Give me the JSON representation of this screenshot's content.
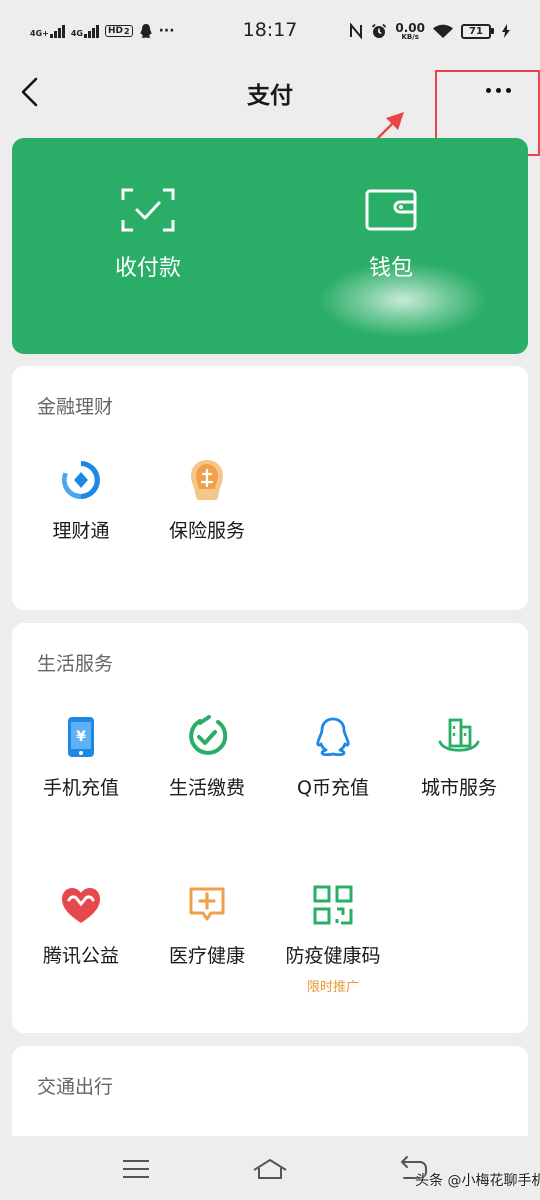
{
  "status_bar": {
    "sim1": "4G+",
    "sim2": "4G",
    "hd": "HD",
    "hd_num": "2",
    "more_dots": "···",
    "time": "18:17",
    "speed_value": "0.00",
    "speed_unit": "KB/s",
    "battery": "71"
  },
  "header": {
    "title": "支付"
  },
  "pay_card": {
    "receive_label": "收付款",
    "wallet_label": "钱包"
  },
  "finance": {
    "title": "金融理财",
    "items": [
      {
        "label": "理财通",
        "icon": "licaitong-icon"
      },
      {
        "label": "保险服务",
        "icon": "insurance-icon"
      }
    ]
  },
  "life": {
    "title": "生活服务",
    "items": [
      {
        "label": "手机充值",
        "icon": "phone-recharge-icon"
      },
      {
        "label": "生活缴费",
        "icon": "utility-payment-icon"
      },
      {
        "label": "Q币充值",
        "icon": "qcoin-icon"
      },
      {
        "label": "城市服务",
        "icon": "city-service-icon"
      },
      {
        "label": "腾讯公益",
        "icon": "charity-icon"
      },
      {
        "label": "医疗健康",
        "icon": "medical-icon"
      },
      {
        "label": "防疫健康码",
        "icon": "health-code-icon",
        "sub": "限时推广"
      }
    ]
  },
  "transport": {
    "title": "交通出行"
  },
  "watermark": "头条 @小梅花聊手机",
  "colors": {
    "brand_green": "#2aae67",
    "blue": "#1e88e5",
    "orange": "#f0a04b",
    "red": "#e5484d",
    "highlight": "#e8464a"
  }
}
